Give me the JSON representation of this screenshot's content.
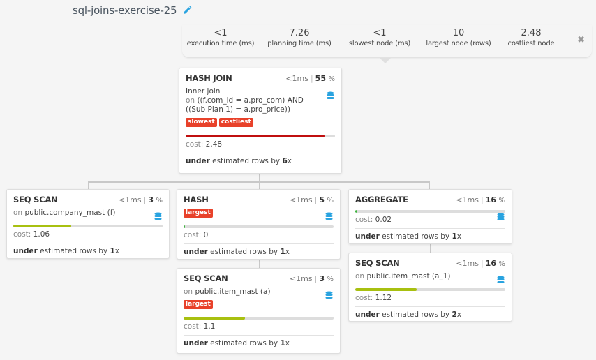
{
  "title": "sql-joins-exercise-25",
  "colors": {
    "slow_bar": "#c00f0f",
    "scan_bar": "#a8c010",
    "small_bar": "#3cb43c",
    "tag_bg": "#e8412a",
    "db_icon": "#29a3e0"
  },
  "stats": [
    {
      "value": "<1",
      "label": "execution time (ms)"
    },
    {
      "value": "7.26",
      "label": "planning time (ms)"
    },
    {
      "value": "<1",
      "label": "slowest node (ms)"
    },
    {
      "value": "10",
      "label": "largest node (rows)"
    },
    {
      "value": "2.48",
      "label": "costliest node"
    }
  ],
  "nodes": {
    "hash_join": {
      "name": "HASH JOIN",
      "time": "<1",
      "time_unit": "ms",
      "pct": "55",
      "pct_sign": "%",
      "desc_prefix": "Inner join",
      "desc_on": "on",
      "desc_cond": "((f.com_id = a.pro_com) AND ((Sub Plan 1) = a.pro_price))",
      "tags": [
        "slowest",
        "costliest"
      ],
      "cost_label": "cost:",
      "cost": "2.48",
      "bar_fraction": 0.93,
      "est_under": "under",
      "est_text": "estimated rows by",
      "est_factor": "6",
      "est_x": "x"
    },
    "seq_scan_company": {
      "name": "SEQ SCAN",
      "time": "<1",
      "time_unit": "ms",
      "pct": "3",
      "pct_sign": "%",
      "desc_on": "on",
      "desc_rel": "public.company_mast (f)",
      "cost_label": "cost:",
      "cost": "1.06",
      "bar_fraction": 0.39,
      "est_under": "under",
      "est_text": "estimated rows by",
      "est_factor": "1",
      "est_x": "x"
    },
    "hash": {
      "name": "HASH",
      "time": "<1",
      "time_unit": "ms",
      "pct": "5",
      "pct_sign": "%",
      "tags": [
        "largest"
      ],
      "cost_label": "cost:",
      "cost": "0",
      "bar_fraction": 0.005,
      "est_under": "under",
      "est_text": "estimated rows by",
      "est_factor": "1",
      "est_x": "x"
    },
    "seq_scan_item": {
      "name": "SEQ SCAN",
      "time": "<1",
      "time_unit": "ms",
      "pct": "3",
      "pct_sign": "%",
      "desc_on": "on",
      "desc_rel": "public.item_mast (a)",
      "tags": [
        "largest"
      ],
      "cost_label": "cost:",
      "cost": "1.1",
      "bar_fraction": 0.41,
      "est_under": "under",
      "est_text": "estimated rows by",
      "est_factor": "1",
      "est_x": "x"
    },
    "aggregate": {
      "name": "AGGREGATE",
      "time": "<1",
      "time_unit": "ms",
      "pct": "16",
      "pct_sign": "%",
      "cost_label": "cost:",
      "cost": "0.02",
      "bar_fraction": 0.01,
      "est_under": "under",
      "est_text": "estimated rows by",
      "est_factor": "1",
      "est_x": "x"
    },
    "seq_scan_item_a1": {
      "name": "SEQ SCAN",
      "time": "<1",
      "time_unit": "ms",
      "pct": "16",
      "pct_sign": "%",
      "desc_on": "on",
      "desc_rel": "public.item_mast (a_1)",
      "cost_label": "cost:",
      "cost": "1.12",
      "bar_fraction": 0.41,
      "est_under": "under",
      "est_text": "estimated rows by",
      "est_factor": "2",
      "est_x": "x"
    }
  }
}
